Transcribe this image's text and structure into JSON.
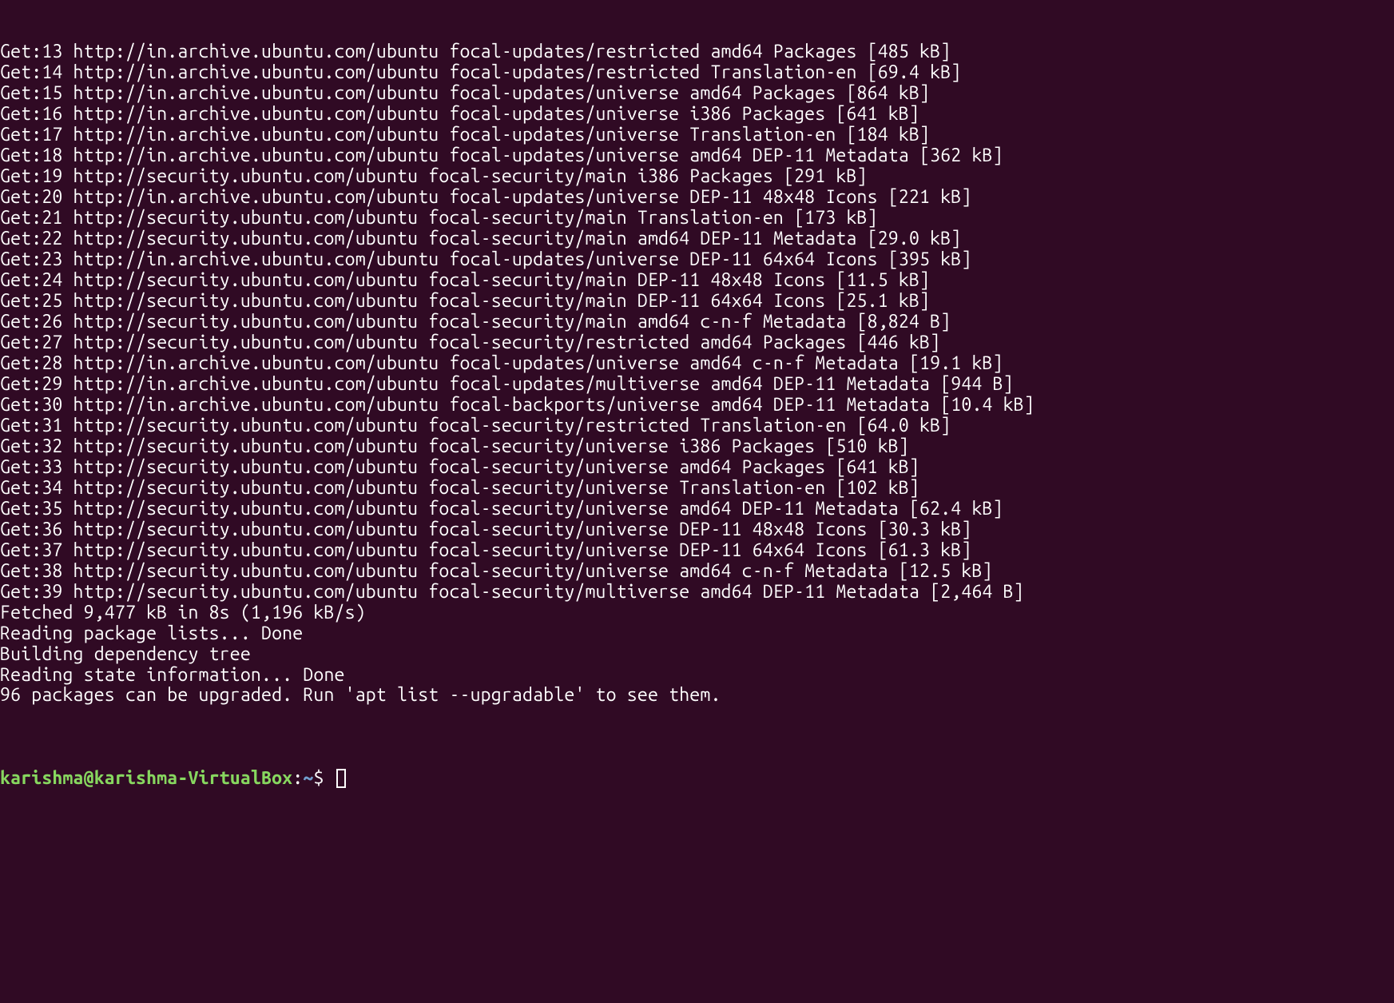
{
  "colors": {
    "background": "#300a24",
    "text": "#ffffff",
    "prompt_user": "#87d75f",
    "prompt_path": "#729fcf"
  },
  "prompt": {
    "user_host": "karishma@karishma-VirtualBox",
    "colon": ":",
    "path": "~",
    "symbol": "$ "
  },
  "lines": [
    "Get:13 http://in.archive.ubuntu.com/ubuntu focal-updates/restricted amd64 Packages [485 kB]",
    "Get:14 http://in.archive.ubuntu.com/ubuntu focal-updates/restricted Translation-en [69.4 kB]",
    "Get:15 http://in.archive.ubuntu.com/ubuntu focal-updates/universe amd64 Packages [864 kB]",
    "Get:16 http://in.archive.ubuntu.com/ubuntu focal-updates/universe i386 Packages [641 kB]",
    "Get:17 http://in.archive.ubuntu.com/ubuntu focal-updates/universe Translation-en [184 kB]",
    "Get:18 http://in.archive.ubuntu.com/ubuntu focal-updates/universe amd64 DEP-11 Metadata [362 kB]",
    "Get:19 http://security.ubuntu.com/ubuntu focal-security/main i386 Packages [291 kB]",
    "Get:20 http://in.archive.ubuntu.com/ubuntu focal-updates/universe DEP-11 48x48 Icons [221 kB]",
    "Get:21 http://security.ubuntu.com/ubuntu focal-security/main Translation-en [173 kB]",
    "Get:22 http://security.ubuntu.com/ubuntu focal-security/main amd64 DEP-11 Metadata [29.0 kB]",
    "Get:23 http://in.archive.ubuntu.com/ubuntu focal-updates/universe DEP-11 64x64 Icons [395 kB]",
    "Get:24 http://security.ubuntu.com/ubuntu focal-security/main DEP-11 48x48 Icons [11.5 kB]",
    "Get:25 http://security.ubuntu.com/ubuntu focal-security/main DEP-11 64x64 Icons [25.1 kB]",
    "Get:26 http://security.ubuntu.com/ubuntu focal-security/main amd64 c-n-f Metadata [8,824 B]",
    "Get:27 http://security.ubuntu.com/ubuntu focal-security/restricted amd64 Packages [446 kB]",
    "Get:28 http://in.archive.ubuntu.com/ubuntu focal-updates/universe amd64 c-n-f Metadata [19.1 kB]",
    "Get:29 http://in.archive.ubuntu.com/ubuntu focal-updates/multiverse amd64 DEP-11 Metadata [944 B]",
    "Get:30 http://in.archive.ubuntu.com/ubuntu focal-backports/universe amd64 DEP-11 Metadata [10.4 kB]",
    "Get:31 http://security.ubuntu.com/ubuntu focal-security/restricted Translation-en [64.0 kB]",
    "Get:32 http://security.ubuntu.com/ubuntu focal-security/universe i386 Packages [510 kB]",
    "Get:33 http://security.ubuntu.com/ubuntu focal-security/universe amd64 Packages [641 kB]",
    "Get:34 http://security.ubuntu.com/ubuntu focal-security/universe Translation-en [102 kB]",
    "Get:35 http://security.ubuntu.com/ubuntu focal-security/universe amd64 DEP-11 Metadata [62.4 kB]",
    "Get:36 http://security.ubuntu.com/ubuntu focal-security/universe DEP-11 48x48 Icons [30.3 kB]",
    "Get:37 http://security.ubuntu.com/ubuntu focal-security/universe DEP-11 64x64 Icons [61.3 kB]",
    "Get:38 http://security.ubuntu.com/ubuntu focal-security/universe amd64 c-n-f Metadata [12.5 kB]",
    "Get:39 http://security.ubuntu.com/ubuntu focal-security/multiverse amd64 DEP-11 Metadata [2,464 B]",
    "Fetched 9,477 kB in 8s (1,196 kB/s)",
    "Reading package lists... Done",
    "Building dependency tree",
    "Reading state information... Done",
    "96 packages can be upgraded. Run 'apt list --upgradable' to see them."
  ]
}
